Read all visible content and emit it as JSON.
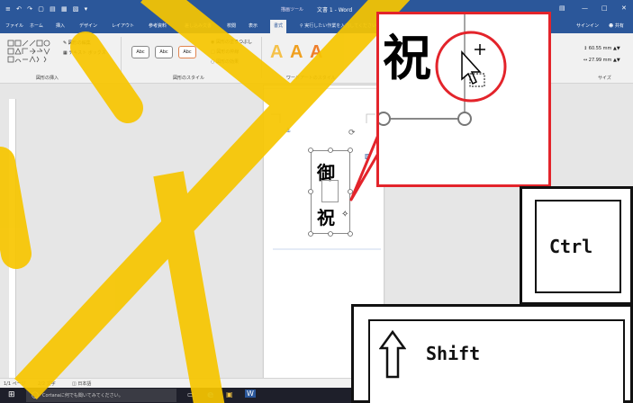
{
  "titlebar": {
    "quick_access": "≡ ↶ ↷ ▢ ▤ ▦ ▧ ▾",
    "context_label": "描画ツール",
    "title": "文書 1 - Word",
    "window_controls": [
      "▤",
      "—",
      "□",
      "✕"
    ]
  },
  "tabs": [
    "ファイル",
    "ホーム",
    "挿入",
    "デザイン",
    "レイアウト",
    "参考資料",
    "差し込み文書",
    "校閲",
    "表示",
    "書式"
  ],
  "tell_me": "実行したい作業を入力してください",
  "account": {
    "signin": "サインイン",
    "share": "共有"
  },
  "ribbon": {
    "edit_shape": "図形の編集",
    "text_box": "テキスト ボックス",
    "insert_shapes_label": "図形の挿入",
    "style_sample": "Abc",
    "fill": "図形の塗りつぶし",
    "outline": "図形の枠線",
    "effects": "図形の効果",
    "shape_styles_label": "図形のスタイル",
    "wordart_sample": "A",
    "wordart_label": "ワードアートのスタイル",
    "height": "60.55 mm",
    "width": "27.99 mm",
    "size_label": "サイズ"
  },
  "document": {
    "char1": "御",
    "char2": "祝"
  },
  "statusbar": {
    "page": "1/1 ページ",
    "chars": "2/2 文字",
    "lang": "日本語"
  },
  "taskbar": {
    "cortana": "Cortanaに何でも聞いてみてください。"
  },
  "zoom": {
    "char": "祝"
  },
  "keys": {
    "ctrl": "Ctrl",
    "shift": "Shift"
  },
  "colors": {
    "word_blue": "#2b579a",
    "callout_red": "#e3242b",
    "watermark_yellow": "#f7c600"
  }
}
